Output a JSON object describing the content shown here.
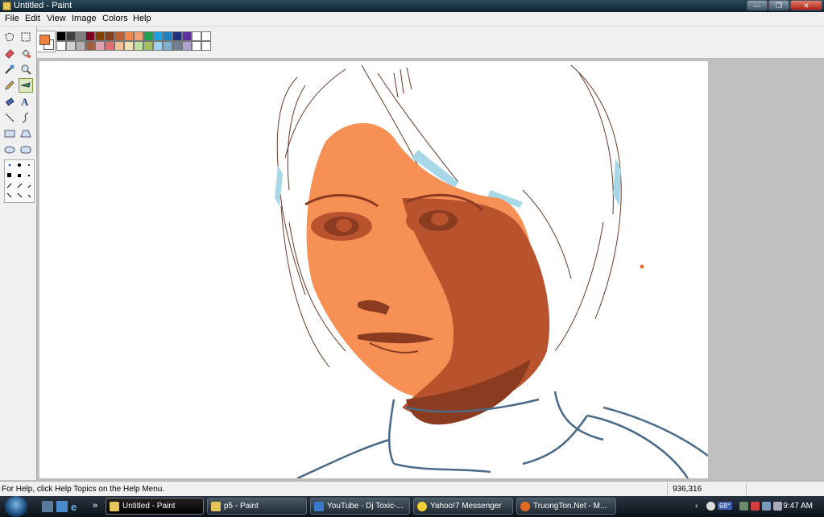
{
  "window": {
    "title": "Untitled - Paint",
    "buttons": [
      "—",
      "❐",
      "✕"
    ]
  },
  "menu": [
    "File",
    "Edit",
    "View",
    "Image",
    "Colors",
    "Help"
  ],
  "current_colors": {
    "foreground": "#f08040",
    "background": "#ffffff"
  },
  "palette": [
    "#000000",
    "#404040",
    "#808080",
    "#800020",
    "#804000",
    "#804020",
    "#c06030",
    "#f08a50",
    "#f0a070",
    "#20a050",
    "#20a0e0",
    "#2080c0",
    "#203080",
    "#6030a0",
    "#ffffff",
    "#ffffff",
    "#ffffff",
    "#d0d0d0",
    "#b0b0b0",
    "#a06040",
    "#e0a0b0",
    "#e07070",
    "#f0c090",
    "#f0e0b0",
    "#c0e0a0",
    "#a0c060",
    "#a0d0f0",
    "#80b0d0",
    "#708090",
    "#b0a0d0",
    "#ffffff",
    "#ffffff"
  ],
  "tools": [
    "free-form-select-icon",
    "select-icon",
    "eraser-icon",
    "fill-icon",
    "color-picker-icon",
    "magnifier-icon",
    "pencil-icon",
    "brush-icon",
    "airbrush-icon",
    "text-icon",
    "line-icon",
    "curve-icon",
    "rectangle-icon",
    "polygon-icon",
    "ellipse-icon",
    "rounded-rectangle-icon"
  ],
  "status": {
    "help": "For Help, click Help Topics on the Help Menu.",
    "coords": "936,316"
  },
  "taskbar": {
    "items": [
      {
        "label": "Untitled - Paint",
        "icon": "paint-icon",
        "active": true
      },
      {
        "label": "p5 - Paint",
        "icon": "paint-icon",
        "active": false
      },
      {
        "label": "YouTube - Dj Toxic-...",
        "icon": "ie-icon",
        "active": false
      },
      {
        "label": "Yahoo!7 Messenger",
        "icon": "yahoo-icon",
        "active": false
      },
      {
        "label": "TruongTon.Net - M...",
        "icon": "firefox-icon",
        "active": false
      }
    ],
    "quick_launch_more": "»",
    "tray_temp": "68°",
    "clock": "9:47 AM"
  },
  "colors": {
    "skin_light": "#f79055",
    "skin_shadow": "#b9532e",
    "skin_dark": "#8a3b20",
    "hair_line": "#6a3a2a",
    "hair_blue": "#a8d8e8",
    "sweater_line": "#4a6a88"
  }
}
